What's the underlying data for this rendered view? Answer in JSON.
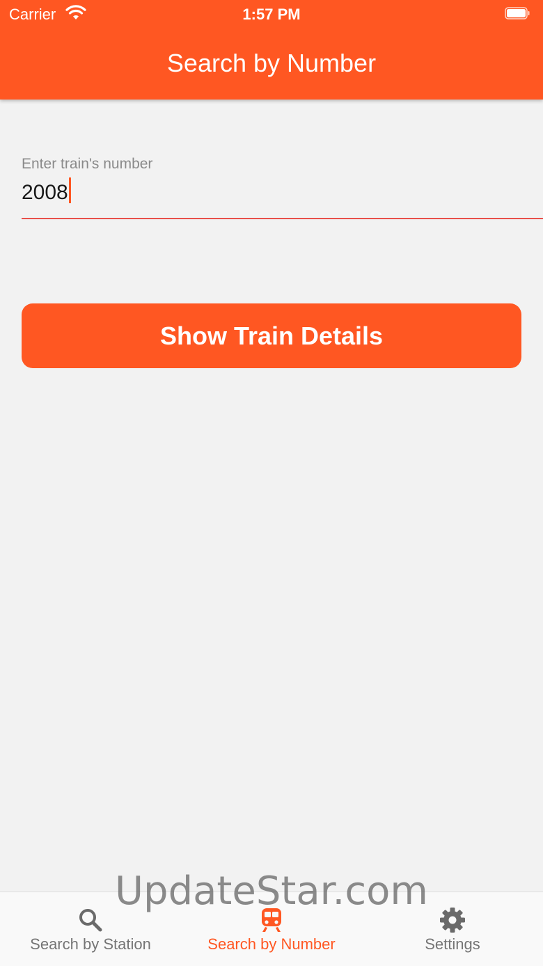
{
  "status_bar": {
    "carrier": "Carrier",
    "time": "1:57 PM",
    "wifi_icon": "wifi-icon",
    "battery_icon": "battery-icon"
  },
  "app_bar": {
    "title": "Search by Number"
  },
  "train_number_field": {
    "label": "Enter train's number",
    "value": "2008"
  },
  "show_details_button": {
    "label": "Show Train Details"
  },
  "bottom_nav": {
    "items": [
      {
        "label": "Search by Station",
        "icon": "search-icon",
        "active": false
      },
      {
        "label": "Search by Number",
        "icon": "train-icon",
        "active": true
      },
      {
        "label": "Settings",
        "icon": "gear-icon",
        "active": false
      }
    ]
  },
  "watermark": "UpdateStar.com",
  "colors": {
    "accent": "#ff5722",
    "background": "#f2f2f2",
    "underline": "#e8504b",
    "inactive": "#757575"
  }
}
